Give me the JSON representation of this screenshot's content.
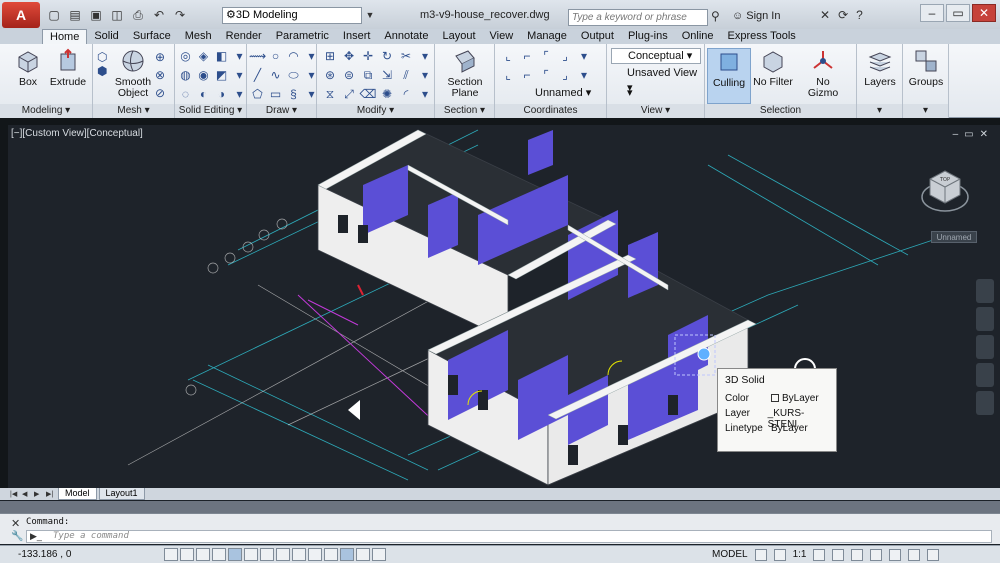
{
  "app": {
    "logo_letter": "A",
    "document_title": "m3-v9-house_recover.dwg"
  },
  "workspace": {
    "selected": "3D Modeling"
  },
  "search": {
    "placeholder": "Type a keyword or phrase"
  },
  "account": {
    "signin_label": "Sign In"
  },
  "ribbon_tabs": [
    "Home",
    "Solid",
    "Surface",
    "Mesh",
    "Render",
    "Parametric",
    "Insert",
    "Annotate",
    "Layout",
    "View",
    "Manage",
    "Output",
    "Plug-ins",
    "Online",
    "Express Tools"
  ],
  "active_tab": "Home",
  "ribbon": {
    "modeling": {
      "label": "Modeling",
      "box": "Box",
      "extrude": "Extrude"
    },
    "mesh": {
      "label": "Mesh",
      "smooth_object_1": "Smooth",
      "smooth_object_2": "Object"
    },
    "solid_editing": {
      "label": "Solid Editing"
    },
    "draw": {
      "label": "Draw"
    },
    "modify": {
      "label": "Modify"
    },
    "section": {
      "label": "Section",
      "section_plane_1": "Section",
      "section_plane_2": "Plane"
    },
    "coordinates": {
      "label": "Coordinates",
      "ucs_name": "Unnamed"
    },
    "view": {
      "label": "View",
      "visual_style": "Conceptual",
      "saved_view": "Unsaved View"
    },
    "selection": {
      "label": "Selection",
      "culling": "Culling",
      "no_filter": "No Filter",
      "no_gizmo": "No Gizmo"
    },
    "layers": {
      "label": "Layers"
    },
    "groups": {
      "label": "Groups"
    }
  },
  "viewport": {
    "label": "[−][Custom View][Conceptual]",
    "ucs_unnamed": "Unnamed",
    "viewcube_face": "TOP"
  },
  "tooltip": {
    "title": "3D Solid",
    "rows": [
      {
        "key": "Color",
        "value": "ByLayer"
      },
      {
        "key": "Layer",
        "value": "_KURS-STENI"
      },
      {
        "key": "Linetype",
        "value": "ByLayer"
      }
    ]
  },
  "layout_tabs": [
    "Model",
    "Layout1"
  ],
  "command": {
    "label": "Command:",
    "placeholder": "Type a command"
  },
  "status": {
    "coords": "-133.186 , 0",
    "model": "MODEL",
    "scale": "1:1"
  },
  "colors": {
    "accent": "#3c6fb8",
    "wall_face": "#5b4fd6",
    "viewport_bg": "#1e232a"
  }
}
